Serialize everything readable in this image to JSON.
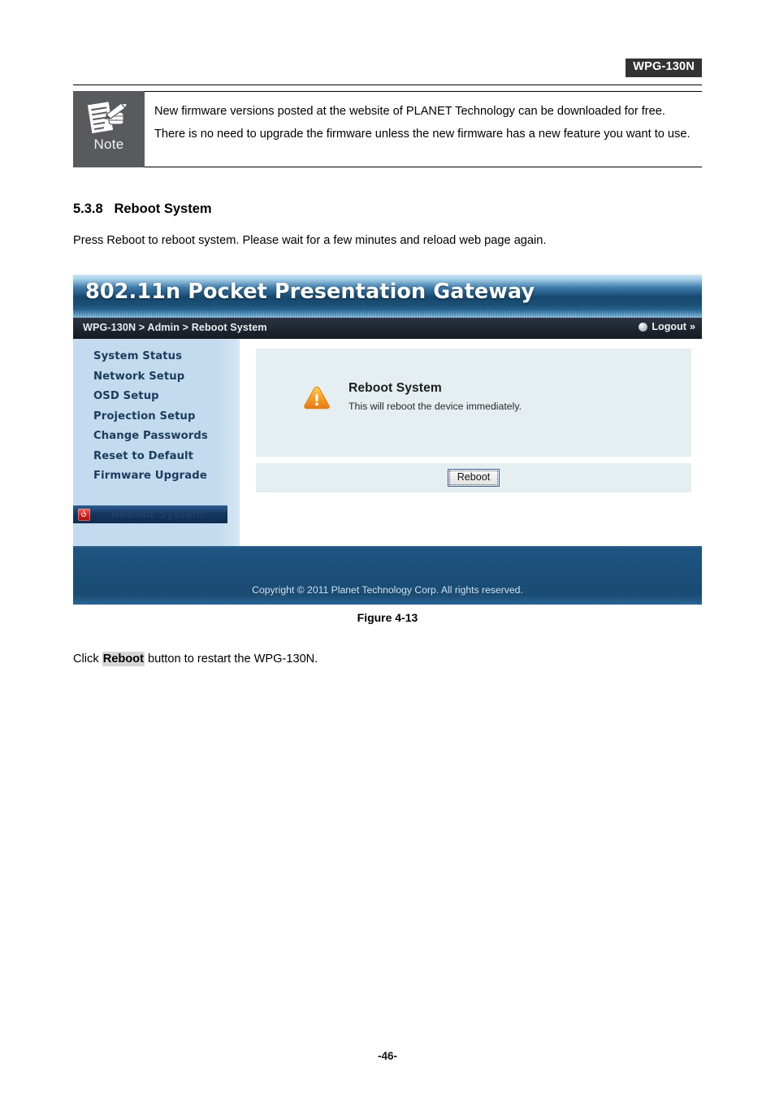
{
  "document": {
    "model_badge": "WPG-130N",
    "page_number": "-46-",
    "figure_caption": "Figure 4-13",
    "section_number": "5.3.8",
    "section_title": "Reboot System",
    "intro_paragraph": "Press Reboot to reboot system. Please wait for a few minutes and reload web page again.",
    "closing_prefix": "Click ",
    "closing_highlight": "Reboot",
    "closing_suffix": " button to restart the WPG-130N."
  },
  "note_box": {
    "label": "Note",
    "icon": "note-pencil-document-icon",
    "text": "New firmware versions posted at the website of PLANET Technology can be downloaded for free. There is no need to upgrade the firmware unless the new firmware has a new feature you want to use."
  },
  "webui": {
    "banner_title": "802.11n Pocket Presentation Gateway",
    "breadcrumb": "WPG-130N > Admin > Reboot System",
    "logout": {
      "label": "Logout",
      "chevron": "»",
      "orb_icon": "logout-orb-icon"
    },
    "sidebar": {
      "items": [
        {
          "label": "System Status"
        },
        {
          "label": "Network Setup"
        },
        {
          "label": "OSD Setup"
        },
        {
          "label": "Projection Setup"
        },
        {
          "label": "Change Passwords"
        },
        {
          "label": "Reset to Default"
        },
        {
          "label": "Firmware Upgrade"
        }
      ],
      "active_item": {
        "label": "Reboot System",
        "icon": "power-icon"
      }
    },
    "panel": {
      "warning_icon": "warning-triangle-icon",
      "heading": "Reboot System",
      "subtext": "This will reboot the device immediately.",
      "button_label": "Reboot"
    },
    "footer": {
      "copyright": "Copyright © 2011 Planet Technology Corp. All rights reserved."
    }
  },
  "colors": {
    "badge_bg": "#333333",
    "note_bg": "#595a5e",
    "banner_dark": "#16486f",
    "navbar_bg": "#1e252e",
    "sidebar_bg": "#c4daee",
    "sidebar_text": "#1b3c5e",
    "active_item_bg": "#14355d",
    "power_icon_red": "#d6201b",
    "panel_bg": "#e5eef1",
    "warning_orange": "#f39a1e",
    "footer_bg": "#1b4f79",
    "button_border": "#3b5f9e"
  }
}
